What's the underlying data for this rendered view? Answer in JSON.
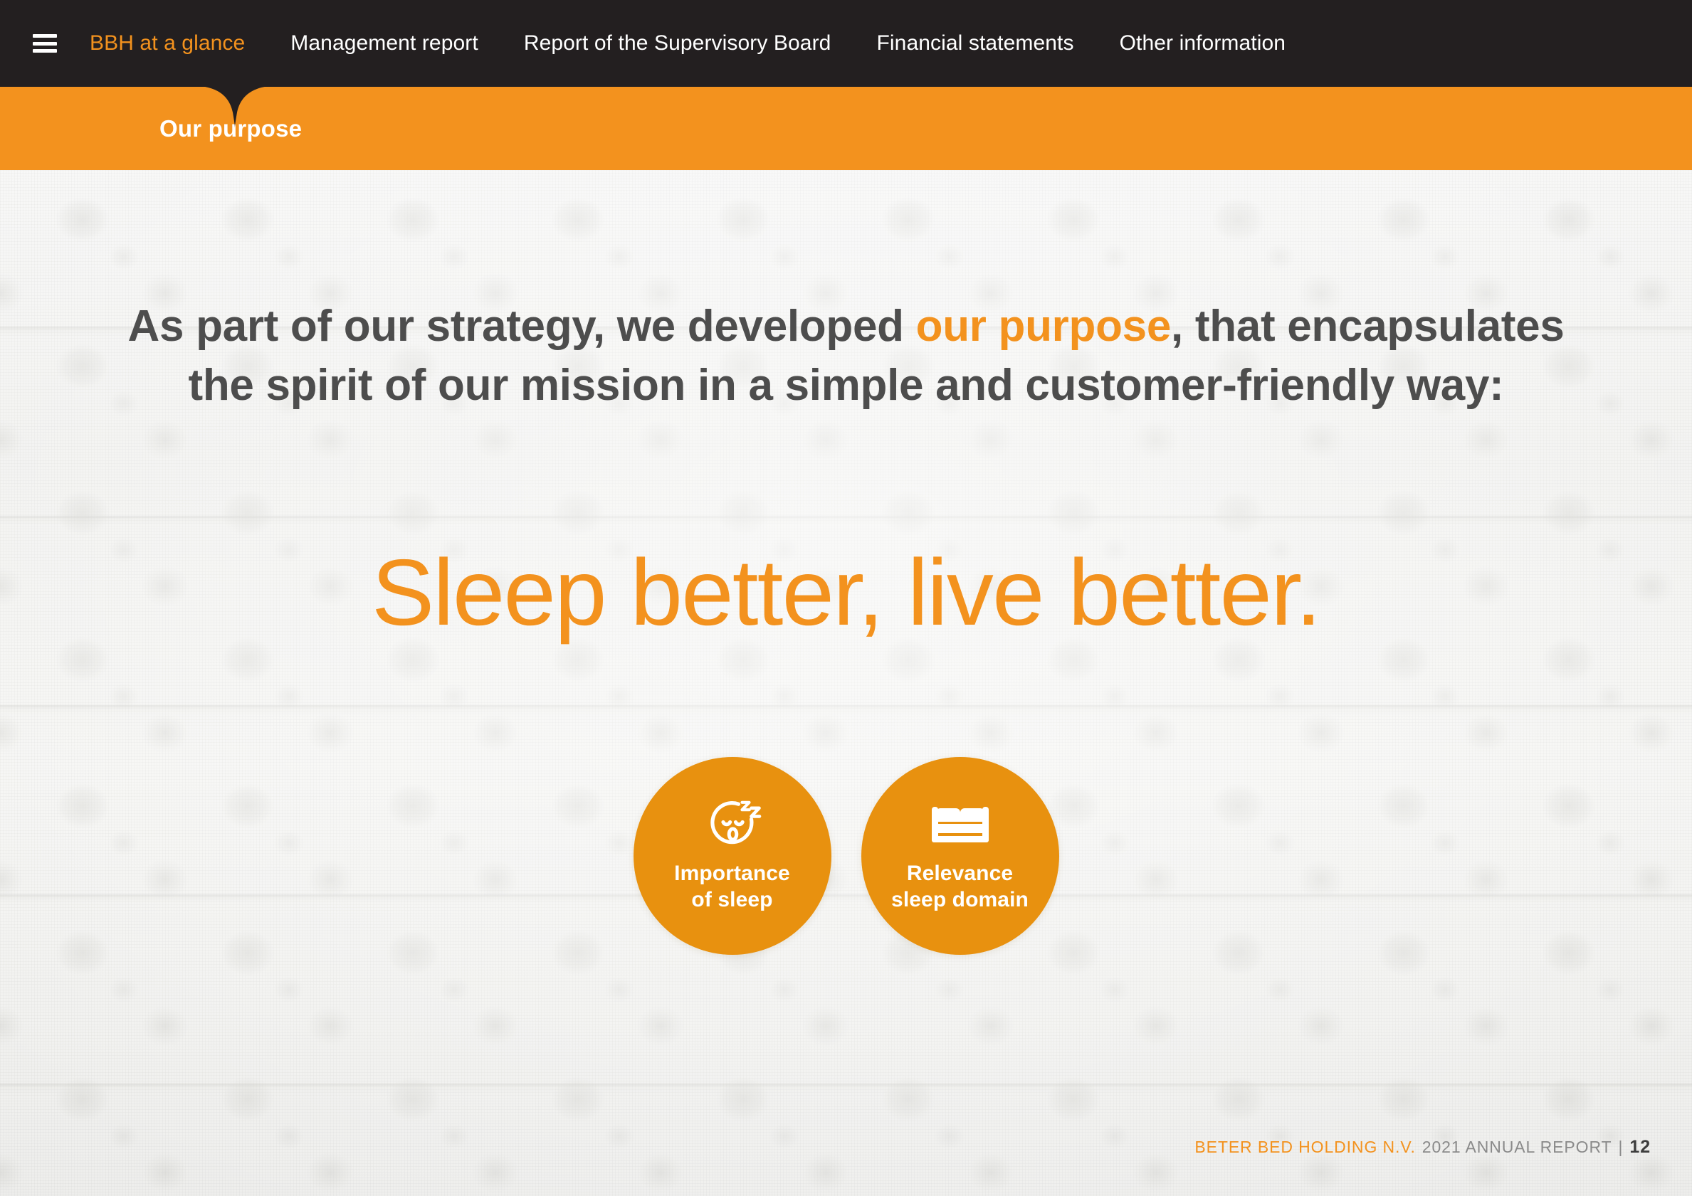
{
  "nav": {
    "menu_icon": "hamburger-icon",
    "items": [
      {
        "label": "BBH at a glance",
        "active": true
      },
      {
        "label": "Management report",
        "active": false
      },
      {
        "label": "Report of the Supervisory Board",
        "active": false
      },
      {
        "label": "Financial statements",
        "active": false
      },
      {
        "label": "Other information",
        "active": false
      }
    ]
  },
  "subheader": {
    "title": "Our purpose"
  },
  "main": {
    "lede_line1_pre": "As part of our strategy, we developed ",
    "lede_accent": "our purpose",
    "lede_line1_post": ", that encapsulates",
    "lede_line2": "the spirit of our mission in a simple and customer-friendly way:",
    "tagline": "Sleep better, live better.",
    "circles": [
      {
        "icon": "sleeping-face-icon",
        "label": "Importance\nof sleep"
      },
      {
        "icon": "bed-icon",
        "label": "Relevance\nsleep domain"
      }
    ]
  },
  "footer": {
    "brand": "BETER BED HOLDING N.V.",
    "document": "2021 ANNUAL REPORT",
    "separator": "|",
    "page": "12"
  },
  "colors": {
    "brand_orange": "#F3921E",
    "circle_orange": "#E8910F",
    "nav_dark": "#231F20",
    "body_text": "#4D4D4D",
    "footer_gray": "#8A8A8A"
  }
}
